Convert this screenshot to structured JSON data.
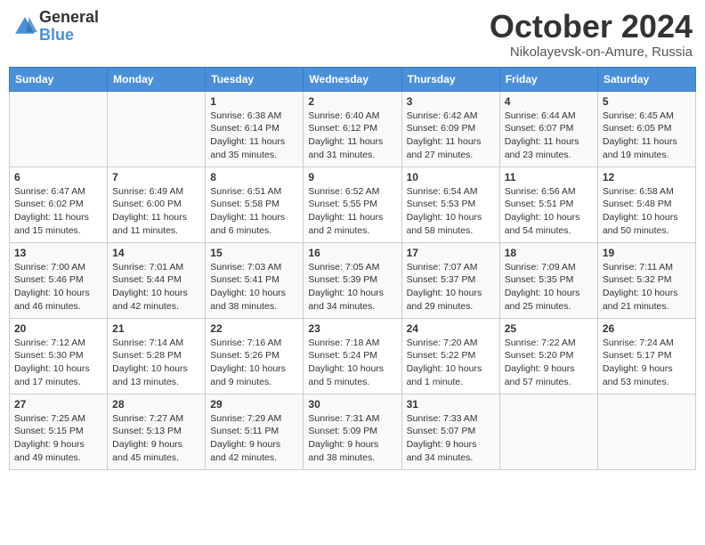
{
  "header": {
    "logo_general": "General",
    "logo_blue": "Blue",
    "month_title": "October 2024",
    "location": "Nikolayevsk-on-Amure, Russia"
  },
  "weekdays": [
    "Sunday",
    "Monday",
    "Tuesday",
    "Wednesday",
    "Thursday",
    "Friday",
    "Saturday"
  ],
  "weeks": [
    [
      {
        "day": "",
        "info": ""
      },
      {
        "day": "",
        "info": ""
      },
      {
        "day": "1",
        "info": "Sunrise: 6:38 AM\nSunset: 6:14 PM\nDaylight: 11 hours and 35 minutes."
      },
      {
        "day": "2",
        "info": "Sunrise: 6:40 AM\nSunset: 6:12 PM\nDaylight: 11 hours and 31 minutes."
      },
      {
        "day": "3",
        "info": "Sunrise: 6:42 AM\nSunset: 6:09 PM\nDaylight: 11 hours and 27 minutes."
      },
      {
        "day": "4",
        "info": "Sunrise: 6:44 AM\nSunset: 6:07 PM\nDaylight: 11 hours and 23 minutes."
      },
      {
        "day": "5",
        "info": "Sunrise: 6:45 AM\nSunset: 6:05 PM\nDaylight: 11 hours and 19 minutes."
      }
    ],
    [
      {
        "day": "6",
        "info": "Sunrise: 6:47 AM\nSunset: 6:02 PM\nDaylight: 11 hours and 15 minutes."
      },
      {
        "day": "7",
        "info": "Sunrise: 6:49 AM\nSunset: 6:00 PM\nDaylight: 11 hours and 11 minutes."
      },
      {
        "day": "8",
        "info": "Sunrise: 6:51 AM\nSunset: 5:58 PM\nDaylight: 11 hours and 6 minutes."
      },
      {
        "day": "9",
        "info": "Sunrise: 6:52 AM\nSunset: 5:55 PM\nDaylight: 11 hours and 2 minutes."
      },
      {
        "day": "10",
        "info": "Sunrise: 6:54 AM\nSunset: 5:53 PM\nDaylight: 10 hours and 58 minutes."
      },
      {
        "day": "11",
        "info": "Sunrise: 6:56 AM\nSunset: 5:51 PM\nDaylight: 10 hours and 54 minutes."
      },
      {
        "day": "12",
        "info": "Sunrise: 6:58 AM\nSunset: 5:48 PM\nDaylight: 10 hours and 50 minutes."
      }
    ],
    [
      {
        "day": "13",
        "info": "Sunrise: 7:00 AM\nSunset: 5:46 PM\nDaylight: 10 hours and 46 minutes."
      },
      {
        "day": "14",
        "info": "Sunrise: 7:01 AM\nSunset: 5:44 PM\nDaylight: 10 hours and 42 minutes."
      },
      {
        "day": "15",
        "info": "Sunrise: 7:03 AM\nSunset: 5:41 PM\nDaylight: 10 hours and 38 minutes."
      },
      {
        "day": "16",
        "info": "Sunrise: 7:05 AM\nSunset: 5:39 PM\nDaylight: 10 hours and 34 minutes."
      },
      {
        "day": "17",
        "info": "Sunrise: 7:07 AM\nSunset: 5:37 PM\nDaylight: 10 hours and 29 minutes."
      },
      {
        "day": "18",
        "info": "Sunrise: 7:09 AM\nSunset: 5:35 PM\nDaylight: 10 hours and 25 minutes."
      },
      {
        "day": "19",
        "info": "Sunrise: 7:11 AM\nSunset: 5:32 PM\nDaylight: 10 hours and 21 minutes."
      }
    ],
    [
      {
        "day": "20",
        "info": "Sunrise: 7:12 AM\nSunset: 5:30 PM\nDaylight: 10 hours and 17 minutes."
      },
      {
        "day": "21",
        "info": "Sunrise: 7:14 AM\nSunset: 5:28 PM\nDaylight: 10 hours and 13 minutes."
      },
      {
        "day": "22",
        "info": "Sunrise: 7:16 AM\nSunset: 5:26 PM\nDaylight: 10 hours and 9 minutes."
      },
      {
        "day": "23",
        "info": "Sunrise: 7:18 AM\nSunset: 5:24 PM\nDaylight: 10 hours and 5 minutes."
      },
      {
        "day": "24",
        "info": "Sunrise: 7:20 AM\nSunset: 5:22 PM\nDaylight: 10 hours and 1 minute."
      },
      {
        "day": "25",
        "info": "Sunrise: 7:22 AM\nSunset: 5:20 PM\nDaylight: 9 hours and 57 minutes."
      },
      {
        "day": "26",
        "info": "Sunrise: 7:24 AM\nSunset: 5:17 PM\nDaylight: 9 hours and 53 minutes."
      }
    ],
    [
      {
        "day": "27",
        "info": "Sunrise: 7:25 AM\nSunset: 5:15 PM\nDaylight: 9 hours and 49 minutes."
      },
      {
        "day": "28",
        "info": "Sunrise: 7:27 AM\nSunset: 5:13 PM\nDaylight: 9 hours and 45 minutes."
      },
      {
        "day": "29",
        "info": "Sunrise: 7:29 AM\nSunset: 5:11 PM\nDaylight: 9 hours and 42 minutes."
      },
      {
        "day": "30",
        "info": "Sunrise: 7:31 AM\nSunset: 5:09 PM\nDaylight: 9 hours and 38 minutes."
      },
      {
        "day": "31",
        "info": "Sunrise: 7:33 AM\nSunset: 5:07 PM\nDaylight: 9 hours and 34 minutes."
      },
      {
        "day": "",
        "info": ""
      },
      {
        "day": "",
        "info": ""
      }
    ]
  ]
}
